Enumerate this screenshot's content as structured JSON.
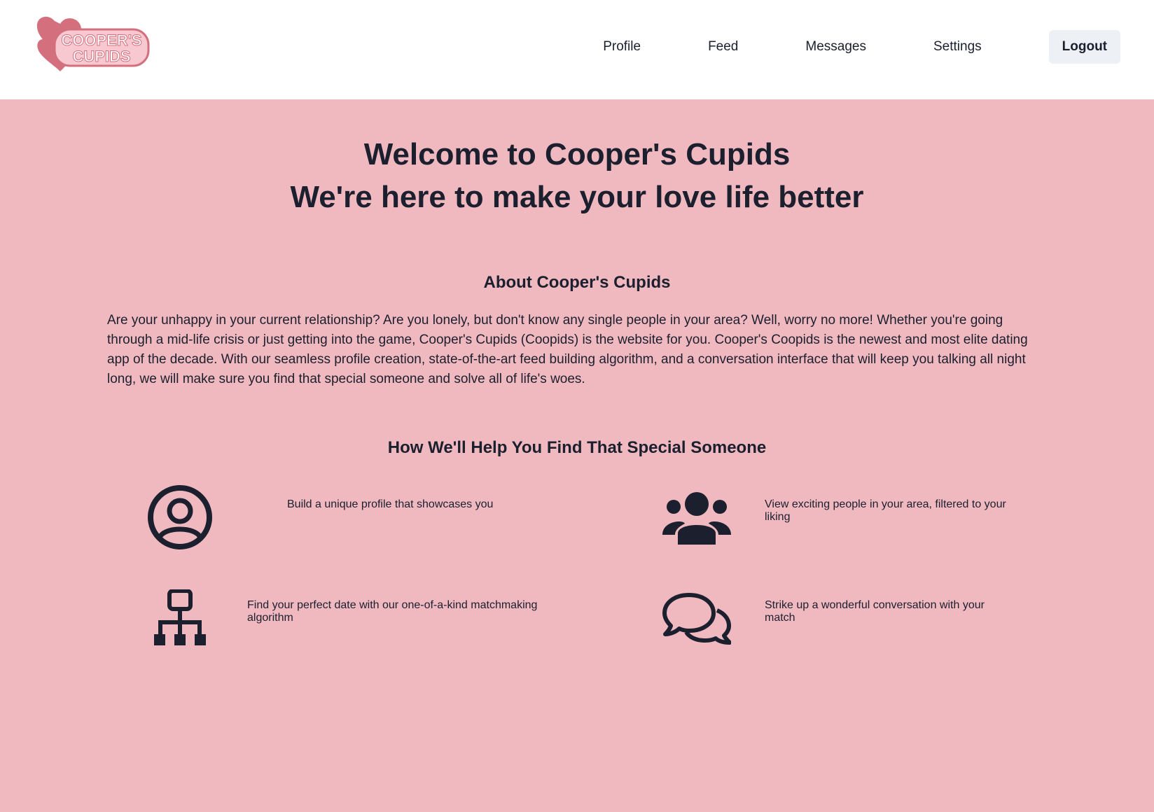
{
  "header": {
    "logo_text_line1": "COOPER'S",
    "logo_text_line2": "CUPIDS",
    "nav": [
      "Profile",
      "Feed",
      "Messages",
      "Settings"
    ],
    "logout_label": "Logout"
  },
  "hero": {
    "line1": "Welcome to Cooper's Cupids",
    "line2": "We're here to make your love life better"
  },
  "about": {
    "title": "About Cooper's Cupids",
    "text": "Are your unhappy in your current relationship? Are you lonely, but don't know any single people in your area? Well, worry no more! Whether you're going through a mid-life crisis or just getting into the game, Cooper's Cupids (Coopids) is the website for you. Cooper's Coopids is the newest and most elite dating app of the decade. With our seamless profile creation, state-of-the-art feed building algorithm, and a conversation interface that will keep you talking all night long, we will make sure you find that special someone and solve all of life's woes."
  },
  "help": {
    "title": "How We'll Help You Find That Special Someone",
    "features": [
      {
        "icon": "user-circle-icon",
        "text": "Build a unique profile that showcases you"
      },
      {
        "icon": "people-group-icon",
        "text": "View exciting people in your area, filtered to your liking"
      },
      {
        "icon": "sitemap-icon",
        "text": "Find your perfect date with our one-of-a-kind matchmaking algorithm"
      },
      {
        "icon": "chat-bubbles-icon",
        "text": "Strike up a wonderful conversation with your match"
      }
    ]
  },
  "colors": {
    "background": "#f0b9c0",
    "header": "#ffffff",
    "text": "#1c1f2e",
    "logo_pink": "#d4707e",
    "logout_bg": "#edf0f4"
  }
}
